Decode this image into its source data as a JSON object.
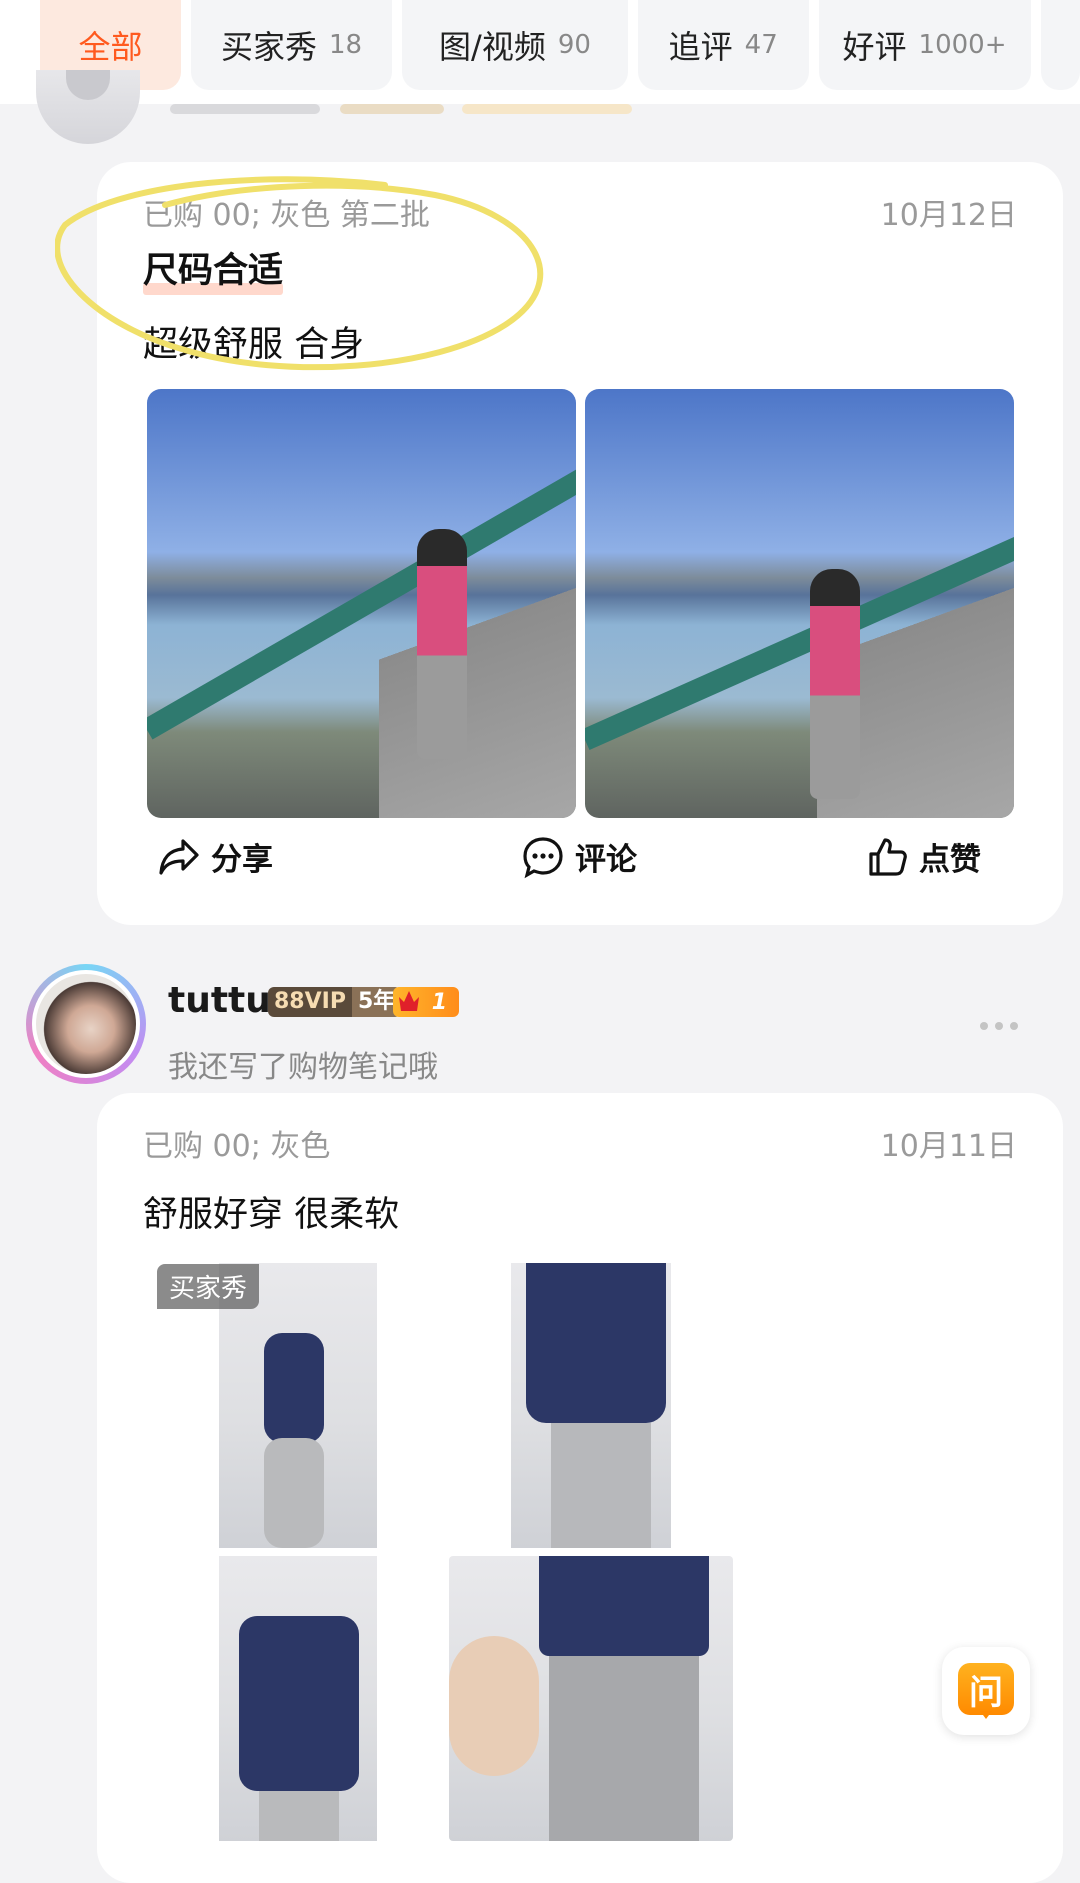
{
  "tabs": [
    {
      "label": "全部",
      "count": "",
      "active": true
    },
    {
      "label": "买家秀",
      "count": "18"
    },
    {
      "label": "图/视频",
      "count": "90"
    },
    {
      "label": "追评",
      "count": "47"
    },
    {
      "label": "好评",
      "count": "1000+"
    }
  ],
  "review1": {
    "meta": "已购 00; 灰色 第二批",
    "date": "10月12日",
    "tag_title": "尺码合适",
    "text": "超级舒服 合身",
    "actions": {
      "share": "分享",
      "comment": "评论",
      "like": "点赞"
    }
  },
  "user2": {
    "name": "tuttu",
    "vip": "88VIP",
    "years": "5年",
    "level": "1",
    "subtitle": "我还写了购物笔记哦"
  },
  "review2": {
    "meta": "已购 00; 灰色",
    "date": "10月11日",
    "text": "舒服好穿 很柔软",
    "badge": "买家秀"
  },
  "ask_button": "问",
  "colors": {
    "accent": "#ff5a1f",
    "annotation": "#f0e06a",
    "ask": "#ff8a00"
  }
}
